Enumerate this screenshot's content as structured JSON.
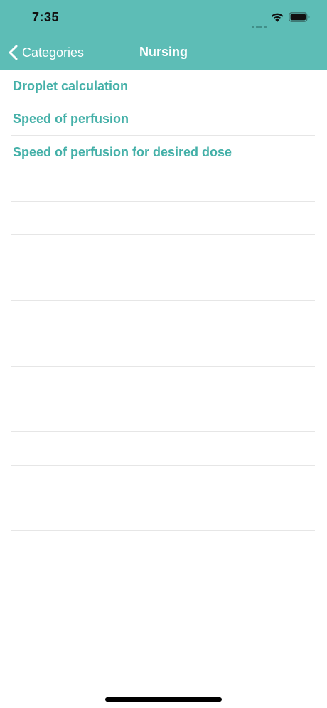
{
  "status_bar": {
    "time": "7:35"
  },
  "navbar": {
    "back_label": "Categories",
    "title": "Nursing",
    "background_color": "#5dbdb6"
  },
  "list": {
    "items": [
      {
        "label": "Droplet calculation"
      },
      {
        "label": "Speed of perfusion"
      },
      {
        "label": "Speed of perfusion for desired dose"
      },
      {
        "label": ""
      },
      {
        "label": ""
      },
      {
        "label": ""
      },
      {
        "label": ""
      },
      {
        "label": ""
      },
      {
        "label": ""
      },
      {
        "label": ""
      },
      {
        "label": ""
      },
      {
        "label": ""
      },
      {
        "label": ""
      },
      {
        "label": ""
      },
      {
        "label": ""
      }
    ],
    "accent_color": "#44b0a8"
  },
  "icons": {
    "back": "chevron-left-icon",
    "wifi": "wifi-icon",
    "battery": "battery-icon",
    "signal": "signal-dots-icon"
  }
}
